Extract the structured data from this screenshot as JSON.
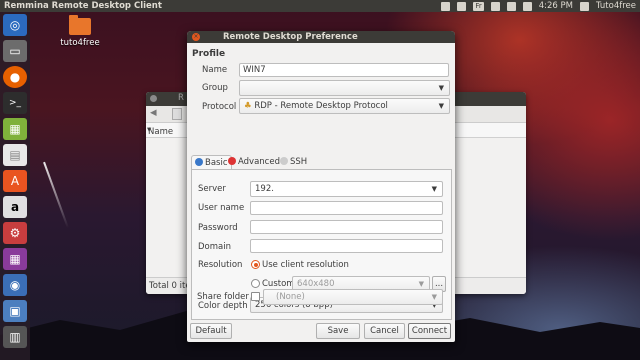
{
  "topbar": {
    "app_title": "Remmina Remote Desktop Client",
    "keyboard": "Fr",
    "time": "4:26 PM",
    "user": "Tuto4free"
  },
  "desktop": {
    "folder_label": "tuto4free"
  },
  "background_window": {
    "title_fragment": "R",
    "column_name": "Name",
    "status": "Total 0 ite"
  },
  "dialog": {
    "title": "Remote Desktop Preference",
    "section": "Profile",
    "name_label": "Name",
    "name_value": "WIN7",
    "group_label": "Group",
    "group_value": "",
    "protocol_label": "Protocol",
    "protocol_value": "RDP - Remote Desktop Protocol",
    "tabs": [
      {
        "label": "Basic",
        "active": true,
        "icon": "info-icon"
      },
      {
        "label": "Advanced",
        "active": false,
        "icon": "advanced-icon"
      },
      {
        "label": "SSH",
        "active": false,
        "icon": "ssh-icon"
      }
    ],
    "basic": {
      "server_label": "Server",
      "server_value": "192.",
      "username_label": "User name",
      "password_label": "Password",
      "domain_label": "Domain",
      "resolution_label": "Resolution",
      "use_client_resolution": "Use client resolution",
      "custom_label": "Custom",
      "custom_value": "640x480",
      "custom_button": "...",
      "color_depth_label": "Color depth",
      "color_depth_value": "256 colors (8 bpp)",
      "share_folder_label": "Share folder",
      "share_folder_value": "(None)"
    },
    "buttons": {
      "default": "Default",
      "save": "Save",
      "cancel": "Cancel",
      "connect": "Connect"
    }
  },
  "colors": {
    "accent": "#e2571e",
    "panel": "#3c3b37"
  }
}
